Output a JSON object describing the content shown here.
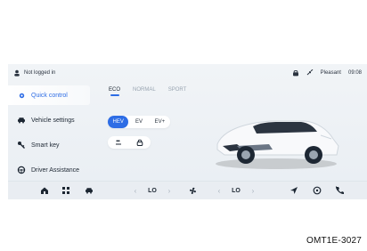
{
  "status": {
    "left_text": "Not logged in",
    "time": "09:08",
    "weather": "Pleasant"
  },
  "sidebar": {
    "items": [
      {
        "label": "Quick control",
        "icon": "gear-icon",
        "active": true
      },
      {
        "label": "Vehicle settings",
        "icon": "car-icon",
        "active": false
      },
      {
        "label": "Smart key",
        "icon": "key-icon",
        "active": false
      },
      {
        "label": "Driver Assistance",
        "icon": "steering-wheel-icon",
        "active": false
      }
    ]
  },
  "tabs": [
    {
      "label": "ECO",
      "active": true
    },
    {
      "label": "NORMAL",
      "active": false
    },
    {
      "label": "SPORT",
      "active": false
    }
  ],
  "modes": [
    {
      "label": "HEV",
      "active": true
    },
    {
      "label": "EV",
      "active": false
    },
    {
      "label": "EV+",
      "active": false
    }
  ],
  "bottom": {
    "left_temp": "LO",
    "right_temp": "LO"
  },
  "caption": "OMT1E-3027",
  "colors": {
    "accent": "#2e6de5",
    "screen_bg": "#eef2f6"
  }
}
